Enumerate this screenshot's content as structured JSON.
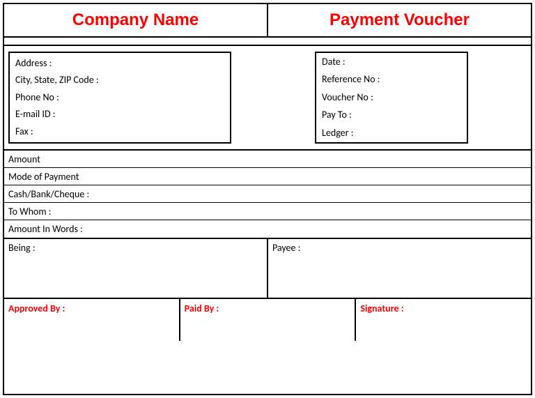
{
  "header": {
    "company": "Company Name",
    "title": "Payment Voucher"
  },
  "companyInfo": {
    "address": "Address :",
    "cityState": "City, State, ZIP Code :",
    "phone": "Phone No :",
    "email": "E-mail ID :",
    "fax": "Fax :"
  },
  "voucherInfo": {
    "date": "Date :",
    "refNo": "Reference No :",
    "voucherNo": "Voucher No :",
    "payTo": "Pay To :",
    "ledger": "Ledger :"
  },
  "details": {
    "amount": "Amount",
    "mode": "Mode of Payment",
    "cashBank": "Cash/Bank/Cheque :",
    "toWhom": "To Whom :",
    "amountWords": "Amount In Words :"
  },
  "dual": {
    "being": "Being :",
    "payee": "Payee :"
  },
  "signatures": {
    "approved": "Approved By :",
    "paid": "Paid By :",
    "signature": "Signature :"
  }
}
